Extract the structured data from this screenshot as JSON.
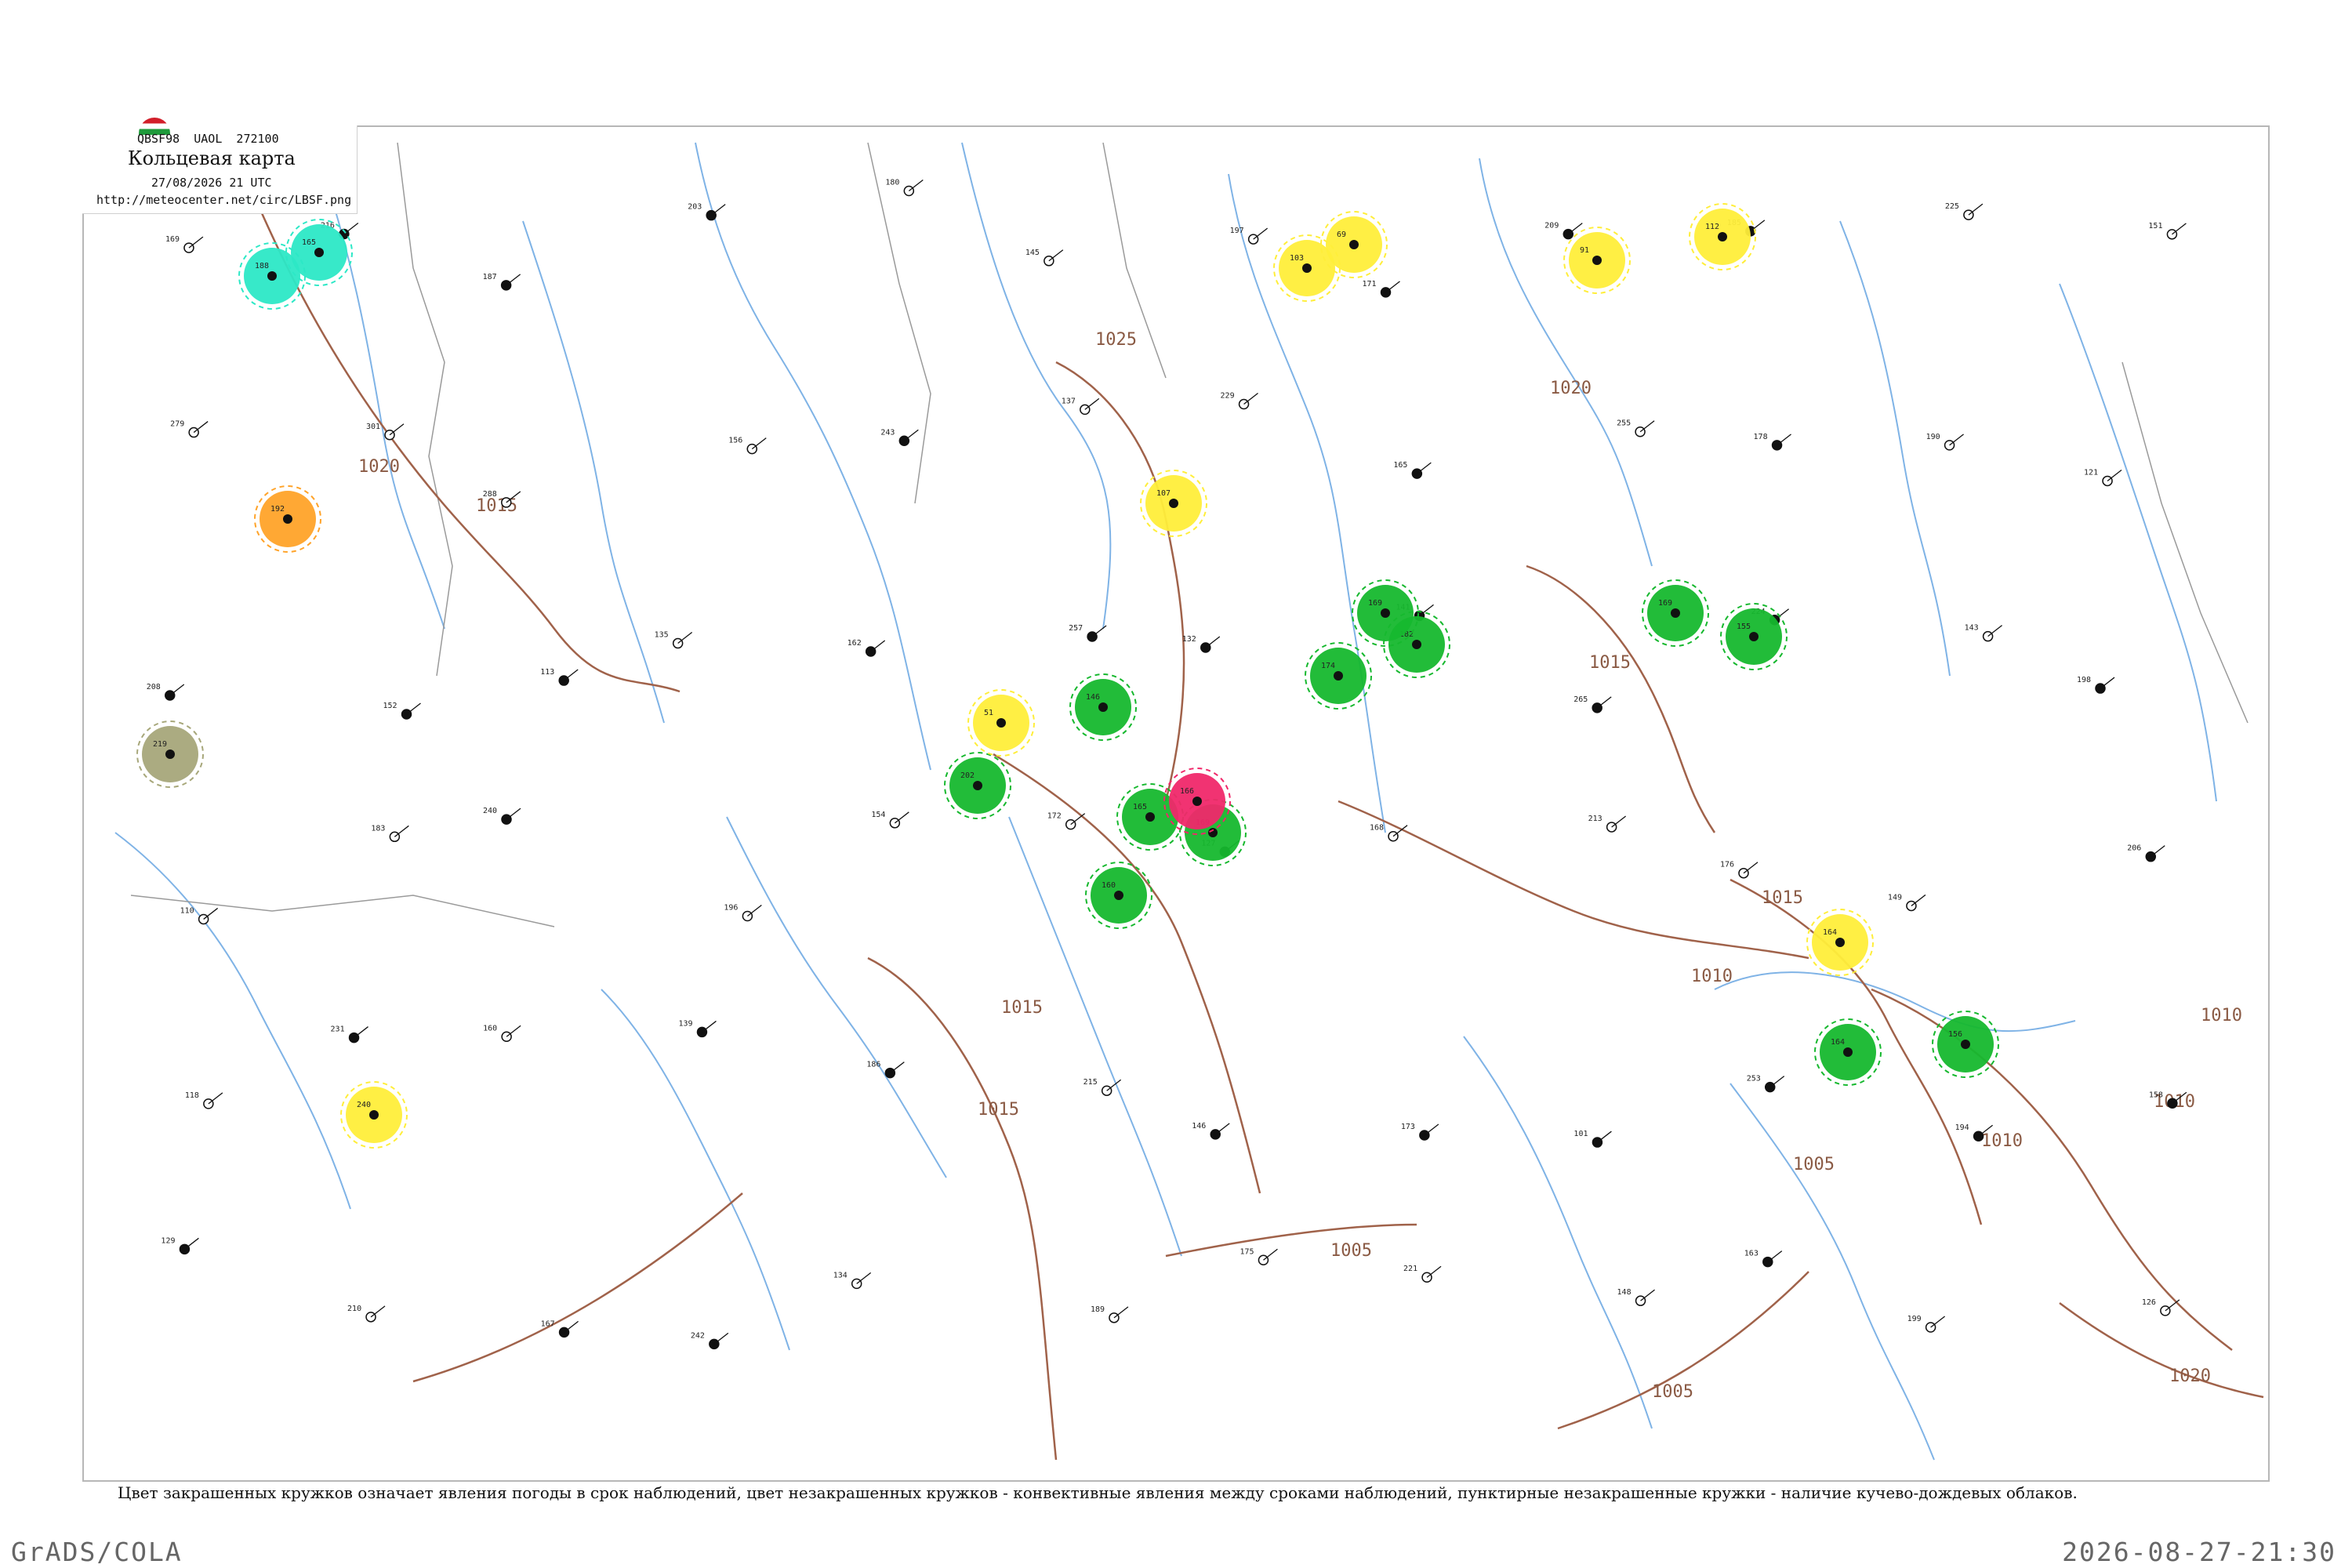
{
  "header": {
    "codes": "QBSF98  UAOL  272100",
    "title": "Кольцевая карта",
    "date": "27/08/2026 21 UTC",
    "url": "http://meteocenter.net/circ/LBSF.png"
  },
  "legend_note": "Цвет закрашенных кружков означает явления погоды в срок наблюдений, цвет незакрашенных кружков - конвективные явления между сроками наблюдений, пунктирные незакрашенные кружки - наличие кучево-дождевых облаков.",
  "footer": {
    "software": "GrADS/COLA",
    "timestamp": "2026-08-27-21:30"
  },
  "isobar_labels": [
    "1025",
    "1020",
    "1020",
    "1015",
    "1015",
    "1015",
    "1015",
    "1010",
    "1010",
    "1010",
    "1010",
    "1005",
    "1005",
    "1005",
    "1020",
    "1015"
  ],
  "colors": {
    "isobar": "#a0624a",
    "river": "#7fb3e6",
    "border": "#9a9a9a",
    "rain": "#16b82e",
    "drizzle_fog": "#ffee3a",
    "thunder": "#f0286a",
    "smoke": "#ffa329",
    "shower": "#2ce8c6",
    "haze": "#a7a77a"
  },
  "weather_spots": [
    {
      "type": "rain",
      "label": "202"
    },
    {
      "type": "rain",
      "label": "146"
    },
    {
      "type": "rain",
      "label": "165"
    },
    {
      "type": "rain",
      "label": "169"
    },
    {
      "type": "rain",
      "label": "174"
    },
    {
      "type": "rain",
      "label": "182"
    },
    {
      "type": "rain",
      "label": "169"
    },
    {
      "type": "rain",
      "label": "169"
    },
    {
      "type": "rain",
      "label": "155"
    },
    {
      "type": "rain",
      "label": "164"
    },
    {
      "type": "rain",
      "label": "156"
    },
    {
      "type": "rain",
      "label": "160"
    },
    {
      "type": "thunder",
      "label": "166"
    },
    {
      "type": "shower",
      "label": "165"
    },
    {
      "type": "shower",
      "label": "188"
    },
    {
      "type": "smoke",
      "label": "192"
    },
    {
      "type": "haze",
      "label": "219"
    },
    {
      "type": "drizzle_fog",
      "label": "51"
    },
    {
      "type": "drizzle_fog",
      "label": "164"
    },
    {
      "type": "drizzle_fog",
      "label": "240"
    },
    {
      "type": "drizzle_fog",
      "label": "107"
    },
    {
      "type": "drizzle_fog",
      "label": "103"
    },
    {
      "type": "drizzle_fog",
      "label": "69"
    },
    {
      "type": "drizzle_fog",
      "label": "91"
    },
    {
      "type": "drizzle_fog",
      "label": "112"
    }
  ],
  "stations": [
    {
      "v": "169"
    },
    {
      "v": "216"
    },
    {
      "v": "187"
    },
    {
      "v": "203"
    },
    {
      "v": "180"
    },
    {
      "v": "145"
    },
    {
      "v": "197"
    },
    {
      "v": "171"
    },
    {
      "v": "209"
    },
    {
      "v": "185"
    },
    {
      "v": "225"
    },
    {
      "v": "151"
    },
    {
      "v": "279"
    },
    {
      "v": "301"
    },
    {
      "v": "288"
    },
    {
      "v": "156"
    },
    {
      "v": "243"
    },
    {
      "v": "137"
    },
    {
      "v": "229"
    },
    {
      "v": "165"
    },
    {
      "v": "255"
    },
    {
      "v": "178"
    },
    {
      "v": "190"
    },
    {
      "v": "121"
    },
    {
      "v": "208"
    },
    {
      "v": "152"
    },
    {
      "v": "113"
    },
    {
      "v": "135"
    },
    {
      "v": "162"
    },
    {
      "v": "257"
    },
    {
      "v": "132"
    },
    {
      "v": "141"
    },
    {
      "v": "265"
    },
    {
      "v": "224"
    },
    {
      "v": "143"
    },
    {
      "v": "198"
    },
    {
      "v": "110"
    },
    {
      "v": "183"
    },
    {
      "v": "240"
    },
    {
      "v": "196"
    },
    {
      "v": "154"
    },
    {
      "v": "172"
    },
    {
      "v": "127"
    },
    {
      "v": "168"
    },
    {
      "v": "213"
    },
    {
      "v": "176"
    },
    {
      "v": "149"
    },
    {
      "v": "206"
    },
    {
      "v": "118"
    },
    {
      "v": "231"
    },
    {
      "v": "160"
    },
    {
      "v": "139"
    },
    {
      "v": "186"
    },
    {
      "v": "215"
    },
    {
      "v": "146"
    },
    {
      "v": "173"
    },
    {
      "v": "101"
    },
    {
      "v": "253"
    },
    {
      "v": "194"
    },
    {
      "v": "158"
    },
    {
      "v": "129"
    },
    {
      "v": "210"
    },
    {
      "v": "167"
    },
    {
      "v": "242"
    },
    {
      "v": "134"
    },
    {
      "v": "189"
    },
    {
      "v": "175"
    },
    {
      "v": "221"
    },
    {
      "v": "148"
    },
    {
      "v": "163"
    },
    {
      "v": "199"
    },
    {
      "v": "126"
    }
  ]
}
